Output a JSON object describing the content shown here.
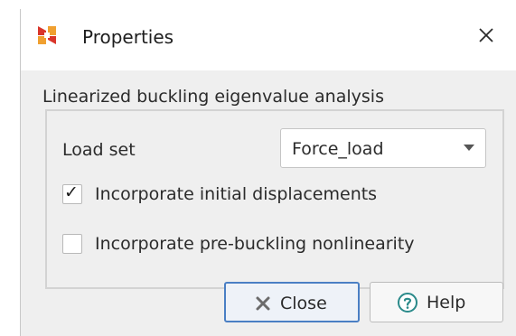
{
  "window": {
    "title": "Properties"
  },
  "dialog": {
    "section_label": "Linearized buckling eigenvalue analysis",
    "load_set": {
      "label": "Load set",
      "selected": "Force_load"
    },
    "options": [
      {
        "label": "Incorporate initial displacements",
        "checked": true
      },
      {
        "label": "Incorporate pre-buckling nonlinearity",
        "checked": false
      }
    ],
    "buttons": {
      "close_label": "Close",
      "help_label": "Help"
    }
  },
  "icons": {
    "app": "app-logo-icon",
    "window_close": "close-icon",
    "close_button": "x-icon",
    "help_button": "help-icon",
    "dropdown": "chevron-down-icon",
    "checkmark": "checkmark-icon"
  },
  "colors": {
    "app_icon_red": "#d9352a",
    "app_icon_orange": "#f0a030",
    "focus_border": "#4a7fc4",
    "help_icon_teal": "#2a8a8a"
  }
}
